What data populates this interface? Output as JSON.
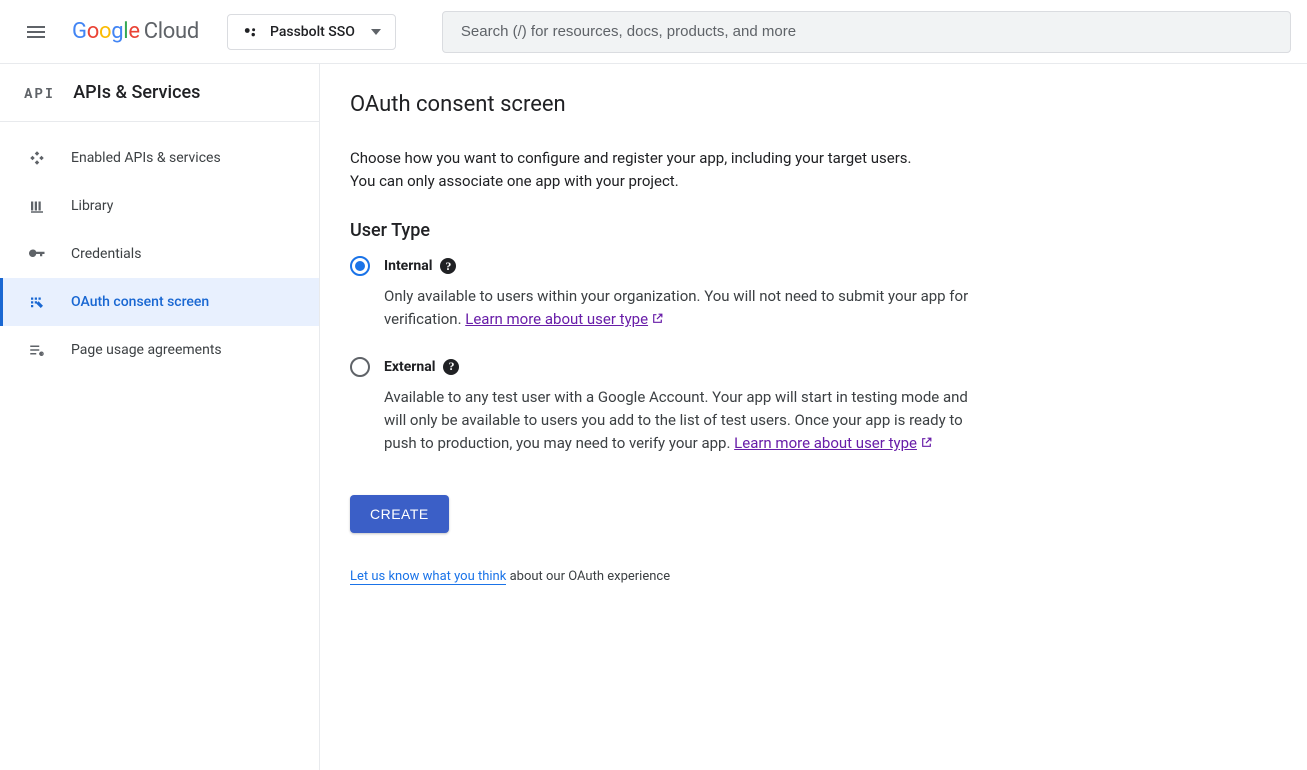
{
  "header": {
    "logo": {
      "google": "Google",
      "cloud": "Cloud"
    },
    "project_name": "Passbolt SSO",
    "search_placeholder": "Search (/) for resources, docs, products, and more"
  },
  "sidebar": {
    "api_badge": "API",
    "title": "APIs & Services",
    "items": [
      {
        "icon": "diamond-icon",
        "label": "Enabled APIs & services",
        "active": false
      },
      {
        "icon": "library-icon",
        "label": "Library",
        "active": false
      },
      {
        "icon": "key-icon",
        "label": "Credentials",
        "active": false
      },
      {
        "icon": "consent-icon",
        "label": "OAuth consent screen",
        "active": true
      },
      {
        "icon": "agreement-icon",
        "label": "Page usage agreements",
        "active": false
      }
    ]
  },
  "main": {
    "title": "OAuth consent screen",
    "intro": "Choose how you want to configure and register your app, including your target users. You can only associate one app with your project.",
    "user_type_heading": "User Type",
    "options": {
      "internal": {
        "label": "Internal",
        "selected": true,
        "description": "Only available to users within your organization. You will not need to submit your app for verification. ",
        "link_text": "Learn more about user type"
      },
      "external": {
        "label": "External",
        "selected": false,
        "description": "Available to any test user with a Google Account. Your app will start in testing mode and will only be available to users you add to the list of test users. Once your app is ready to push to production, you may need to verify your app. ",
        "link_text": "Learn more about user type"
      }
    },
    "create_button": "CREATE",
    "feedback": {
      "link": "Let us know what you think",
      "rest": " about our OAuth experience"
    }
  }
}
